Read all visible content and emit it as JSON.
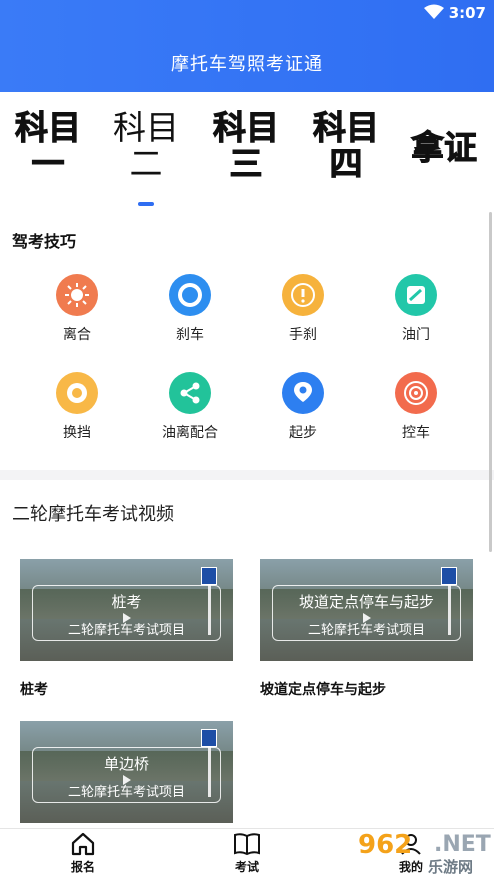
{
  "status_bar": {
    "time": "3:07"
  },
  "app": {
    "title": "摩托车驾照考证通"
  },
  "tabs": [
    {
      "line1": "科目",
      "line2": "一"
    },
    {
      "line1": "科目",
      "line2": "二"
    },
    {
      "line1": "科目",
      "line2": "三"
    },
    {
      "line1": "科目",
      "line2": "四"
    },
    {
      "line1": "拿证",
      "line2": ""
    }
  ],
  "skills": {
    "title": "驾考技巧",
    "items": [
      {
        "label": "离合",
        "icon": "sun-icon",
        "color": "#f07b4f"
      },
      {
        "label": "刹车",
        "icon": "brake-icon",
        "color": "#2d8ef0"
      },
      {
        "label": "手刹",
        "icon": "alert-icon",
        "color": "#f6b23c"
      },
      {
        "label": "油门",
        "icon": "pedal-icon",
        "color": "#22c7a9"
      },
      {
        "label": "换挡",
        "icon": "gear-icon",
        "color": "#f8b847"
      },
      {
        "label": "油离配合",
        "icon": "share-icon",
        "color": "#22c39a"
      },
      {
        "label": "起步",
        "icon": "location-icon",
        "color": "#2d7ff0"
      },
      {
        "label": "控车",
        "icon": "target-icon",
        "color": "#f26b4d"
      }
    ]
  },
  "videos": {
    "title": "二轮摩托车考试视频",
    "items": [
      {
        "thumb_title": "桩考",
        "thumb_sub": "二轮摩托车考试项目",
        "caption": "桩考"
      },
      {
        "thumb_title": "坡道定点停车与起步",
        "thumb_sub": "二轮摩托车考试项目",
        "caption": "坡道定点停车与起步"
      },
      {
        "thumb_title": "单边桥",
        "thumb_sub": "二轮摩托车考试项目",
        "caption": ""
      }
    ]
  },
  "bottom_nav": [
    {
      "label": "报名",
      "icon": "home-icon"
    },
    {
      "label": "考试",
      "icon": "book-icon"
    },
    {
      "label": "我的",
      "icon": "user-icon"
    }
  ],
  "watermark": {
    "brand": "962",
    "suffix": ".NET",
    "cn": "乐游网"
  },
  "colors": {
    "primary": "#2f6ef2"
  }
}
